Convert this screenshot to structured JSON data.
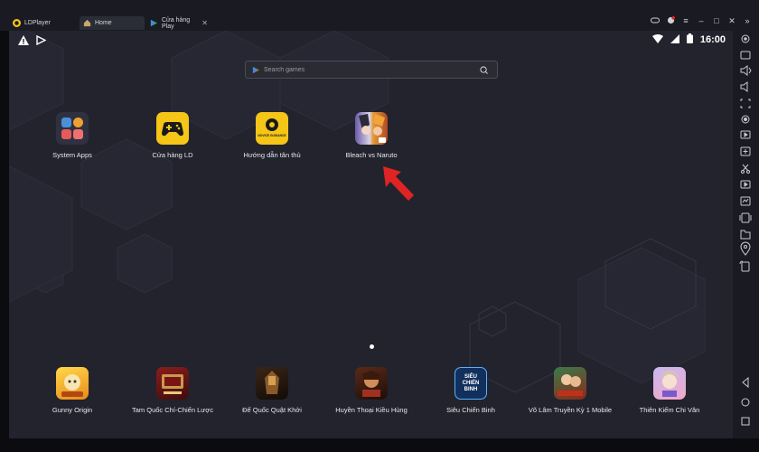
{
  "titlebar": {
    "app_name": "LDPlayer",
    "tabs": [
      {
        "label": "Home"
      },
      {
        "label": "Cửa hàng Play"
      }
    ]
  },
  "status": {
    "time": "16:00"
  },
  "search": {
    "placeholder": "Search games"
  },
  "desktop_apps": [
    {
      "label": "System Apps",
      "icon": "system-apps-icon"
    },
    {
      "label": "Cửa hàng LD",
      "icon": "gamepad-icon"
    },
    {
      "label": "Hướng dẫn tân thủ",
      "icon": "novice-guidance-icon",
      "icon_text": "NOVICE GUIDANCE"
    },
    {
      "label": "Bleach vs Naruto",
      "icon": "bleach-vs-naruto-icon"
    }
  ],
  "dock_apps": [
    {
      "label": "Gunny Origin",
      "icon": "gunny-origin-icon"
    },
    {
      "label": "Tam Quốc Chí-Chiến Lược",
      "icon": "tam-quoc-chi-icon"
    },
    {
      "label": "Đế Quốc Quật Khởi",
      "icon": "de-quoc-quat-khoi-icon"
    },
    {
      "label": "Huyền Thoại Kiều Hùng",
      "icon": "huyen-thoai-kieu-hung-icon"
    },
    {
      "label": "Siêu Chiến Binh",
      "icon": "sieu-chien-binh-icon",
      "icon_text": "SIÊU CHIẾN BINH"
    },
    {
      "label": "Võ Lâm Truyền Kỳ 1 Mobile",
      "icon": "vo-lam-truyen-ky-icon"
    },
    {
      "label": "Thiên Kiếm Chi Vân",
      "icon": "thien-kiem-chi-van-icon"
    }
  ],
  "colors": {
    "accent_yellow": "#f5c518",
    "arrow_red": "#e02424",
    "screen_bg": "#22232d"
  }
}
